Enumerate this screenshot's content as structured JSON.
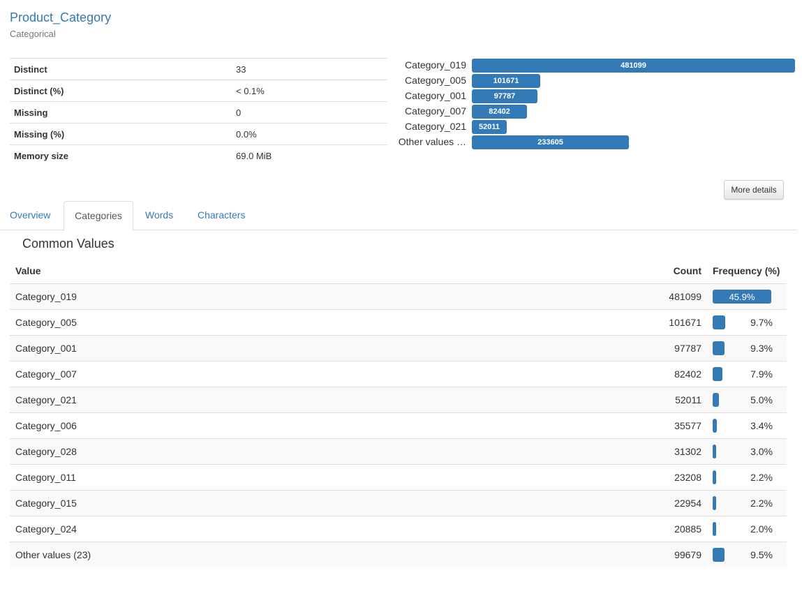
{
  "variable": {
    "name": "Product_Category",
    "type": "Categorical"
  },
  "stats": [
    {
      "label": "Distinct",
      "value": "33"
    },
    {
      "label": "Distinct (%)",
      "value": "< 0.1%"
    },
    {
      "label": "Missing",
      "value": "0"
    },
    {
      "label": "Missing (%)",
      "value": "0.0%"
    },
    {
      "label": "Memory size",
      "value": "69.0 MiB"
    }
  ],
  "mini_chart": {
    "max": 481099,
    "rows": [
      {
        "label": "Category_019",
        "value": 481099,
        "value_text": "481099"
      },
      {
        "label": "Category_005",
        "value": 101671,
        "value_text": "101671"
      },
      {
        "label": "Category_001",
        "value": 97787,
        "value_text": "97787"
      },
      {
        "label": "Category_007",
        "value": 82402,
        "value_text": "82402"
      },
      {
        "label": "Category_021",
        "value": 52011,
        "value_text": "52011"
      },
      {
        "label": "Other values …",
        "value": 233605,
        "value_text": "233605"
      }
    ]
  },
  "more_details_label": "More details",
  "tabs": [
    {
      "label": "Overview",
      "active": false
    },
    {
      "label": "Categories",
      "active": true
    },
    {
      "label": "Words",
      "active": false
    },
    {
      "label": "Characters",
      "active": false
    }
  ],
  "common_values": {
    "title": "Common Values",
    "headers": {
      "value": "Value",
      "count": "Count",
      "frequency": "Frequency (%)"
    },
    "rows": [
      {
        "value": "Category_019",
        "count": "481099",
        "pct": "45.9%",
        "fraction": 0.459
      },
      {
        "value": "Category_005",
        "count": "101671",
        "pct": "9.7%",
        "fraction": 0.097
      },
      {
        "value": "Category_001",
        "count": "97787",
        "pct": "9.3%",
        "fraction": 0.093
      },
      {
        "value": "Category_007",
        "count": "82402",
        "pct": "7.9%",
        "fraction": 0.079
      },
      {
        "value": "Category_021",
        "count": "52011",
        "pct": "5.0%",
        "fraction": 0.05
      },
      {
        "value": "Category_006",
        "count": "35577",
        "pct": "3.4%",
        "fraction": 0.034
      },
      {
        "value": "Category_028",
        "count": "31302",
        "pct": "3.0%",
        "fraction": 0.03
      },
      {
        "value": "Category_011",
        "count": "23208",
        "pct": "2.2%",
        "fraction": 0.022
      },
      {
        "value": "Category_015",
        "count": "22954",
        "pct": "2.2%",
        "fraction": 0.022
      },
      {
        "value": "Category_024",
        "count": "20885",
        "pct": "2.0%",
        "fraction": 0.02
      },
      {
        "value": "Other values (23)",
        "count": "99679",
        "pct": "9.5%",
        "fraction": 0.095
      }
    ]
  },
  "colors": {
    "accent": "#337ab7",
    "border": "#dddddd",
    "stripe": "#f9f9f9"
  }
}
